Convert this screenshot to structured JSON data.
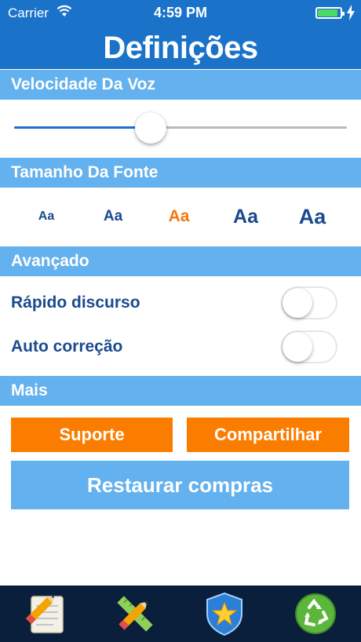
{
  "status_bar": {
    "carrier": "Carrier",
    "time": "4:59 PM",
    "battery_level": 0.9
  },
  "header": {
    "title": "Definições"
  },
  "sections": {
    "voice_speed": "Velocidade Da Voz",
    "font_size": "Tamanho Da Fonte",
    "advanced": "Avançado",
    "more": "Mais"
  },
  "voice_speed": {
    "value": 0.41
  },
  "font_options": [
    {
      "label": "Aa",
      "selected": false
    },
    {
      "label": "Aa",
      "selected": false
    },
    {
      "label": "Aa",
      "selected": true
    },
    {
      "label": "Aa",
      "selected": false
    },
    {
      "label": "Aa",
      "selected": false
    }
  ],
  "toggles": [
    {
      "label": "Rápido discurso",
      "on": false
    },
    {
      "label": "Auto correção",
      "on": false
    }
  ],
  "buttons": {
    "support": "Suporte",
    "share": "Compartilhar",
    "restore": "Restaurar compras"
  },
  "tab_bar": {
    "items": [
      {
        "icon": "notepad-pencil-icon"
      },
      {
        "icon": "ruler-pencil-icon"
      },
      {
        "icon": "star-shield-icon"
      },
      {
        "icon": "recycle-icon"
      }
    ]
  },
  "colors": {
    "primary": "#1a73c9",
    "section": "#63b1ee",
    "accent": "#fb7d00",
    "text": "#1a4a8e",
    "tab_bar": "#0a1f3c"
  }
}
